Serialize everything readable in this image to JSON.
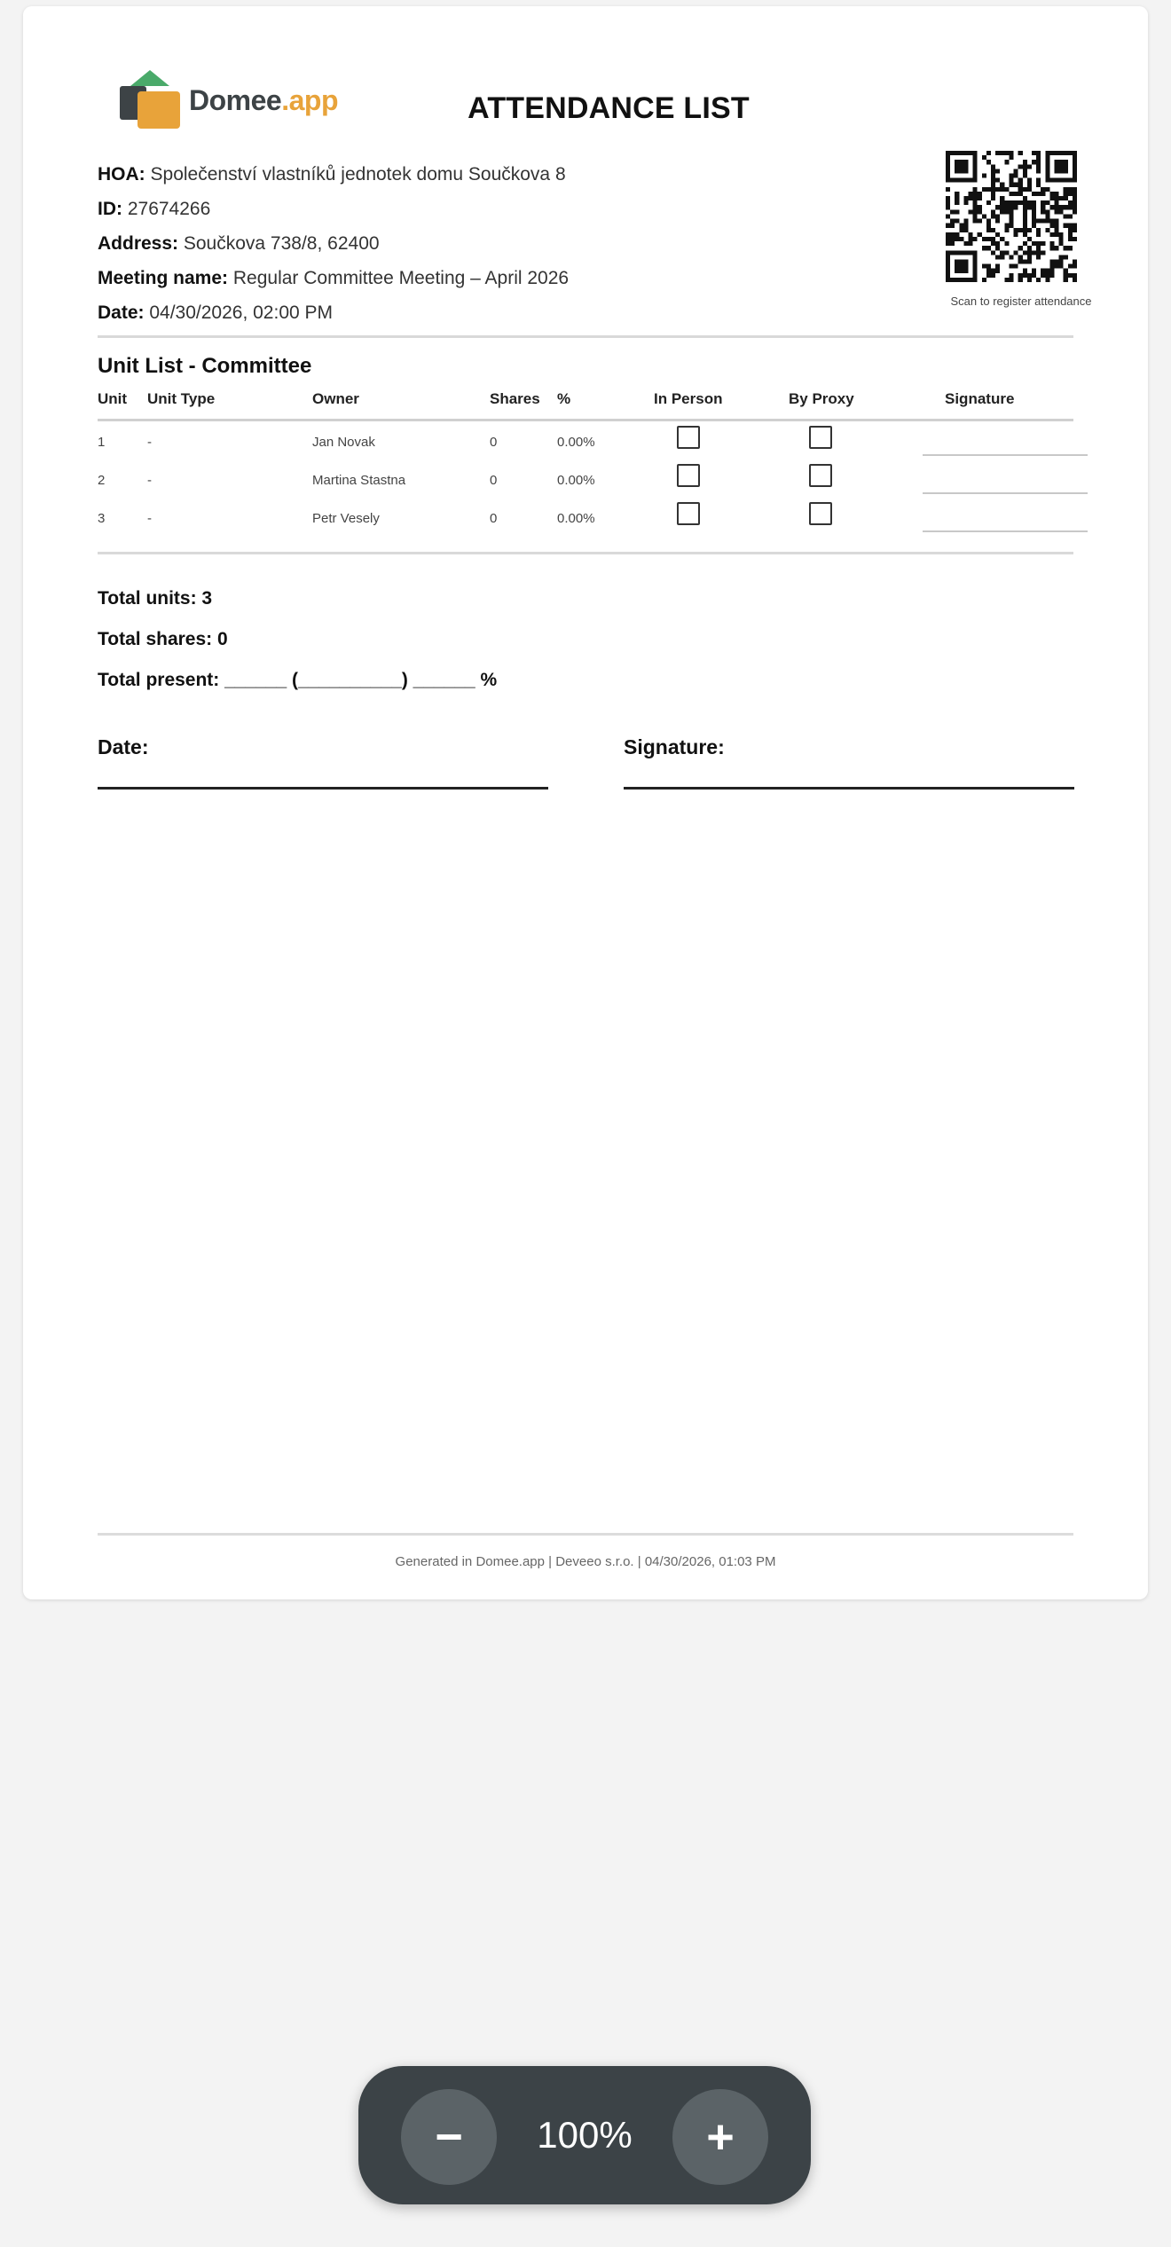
{
  "logo": {
    "name_main": "Domee",
    "name_accent": ".app",
    "colors": {
      "roof": "#4aaa6a",
      "back": "#3d4346",
      "front": "#e8a33a"
    }
  },
  "document": {
    "title": "ATTENDANCE LIST",
    "info": [
      {
        "key": "HOA:",
        "value": "Společenství vlastníků jednotek domu  Součkova 8"
      },
      {
        "key": "ID:",
        "value": "27674266"
      },
      {
        "key": "Address:",
        "value": "Součkova 738/8, 62400"
      },
      {
        "key": "Meeting name:",
        "value": "Regular Committee Meeting – April 2026"
      },
      {
        "key": "Date:",
        "value": "04/30/2026, 02:00 PM"
      }
    ],
    "qr_caption": "Scan to register attendance",
    "section_title": "Unit List - Committee",
    "table": {
      "headers": {
        "unit": "Unit",
        "unit_type": "Unit Type",
        "owner": "Owner",
        "shares": "Shares",
        "percent": "%",
        "in_person": "In Person",
        "by_proxy": "By Proxy",
        "signature": "Signature"
      },
      "rows": [
        {
          "unit": "1",
          "unit_type": "-",
          "owner": "Jan Novak",
          "shares": "0",
          "percent": "0.00%"
        },
        {
          "unit": "2",
          "unit_type": "-",
          "owner": "Martina Stastna",
          "shares": "0",
          "percent": "0.00%"
        },
        {
          "unit": "3",
          "unit_type": "-",
          "owner": "Petr Vesely",
          "shares": "0",
          "percent": "0.00%"
        }
      ]
    },
    "totals": {
      "units": "Total units: 3",
      "shares": "Total shares: 0",
      "present": "Total present: ______ (__________) ______ %"
    },
    "sign": {
      "date_label": "Date:",
      "signature_label": "Signature:"
    },
    "footer": "Generated in Domee.app | Deveeo s.r.o. | 04/30/2026, 01:03 PM"
  },
  "zoom": {
    "value": "100%",
    "minus_label": "−",
    "plus_label": "+"
  }
}
